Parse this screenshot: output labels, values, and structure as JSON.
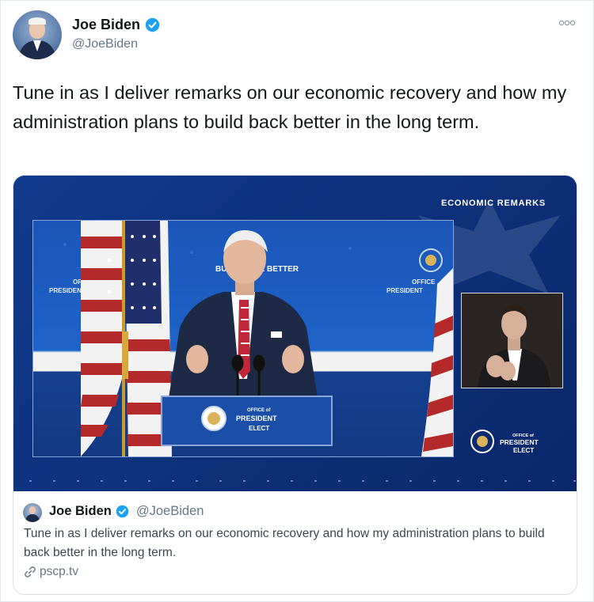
{
  "tweet": {
    "author_name": "Joe Biden",
    "author_handle": "@JoeBiden",
    "text": "Tune in as I deliver remarks on our economic recovery and how my administration plans to build back better in the long term."
  },
  "media": {
    "overlay_title": "ECONOMIC REMARKS",
    "banner_text": "BUILD BACK BETTER",
    "podium_text": [
      "OFFICE of",
      "PRESIDENT",
      "ELECT"
    ],
    "side_logo_text": [
      "OFFICE of",
      "PRESIDENT",
      "ELECT"
    ],
    "backdrop_left_text": [
      "OFFICE",
      "PRESIDENT"
    ],
    "backdrop_right_text": [
      "OFFICE",
      "PRESIDENT"
    ]
  },
  "card": {
    "author_name": "Joe Biden",
    "author_handle": "@JoeBiden",
    "text": "Tune in as I deliver remarks on our economic recovery and how my administration plans to build back better in the long term.",
    "link_domain": "pscp.tv"
  },
  "icons": {
    "verified": "verified-badge-icon",
    "more": "more-options-icon",
    "link": "link-icon"
  },
  "colors": {
    "verified_blue": "#1da1f2",
    "media_navy": "#0d2f78",
    "backdrop_blue": "#1e63c8",
    "muted_text": "#657786"
  }
}
